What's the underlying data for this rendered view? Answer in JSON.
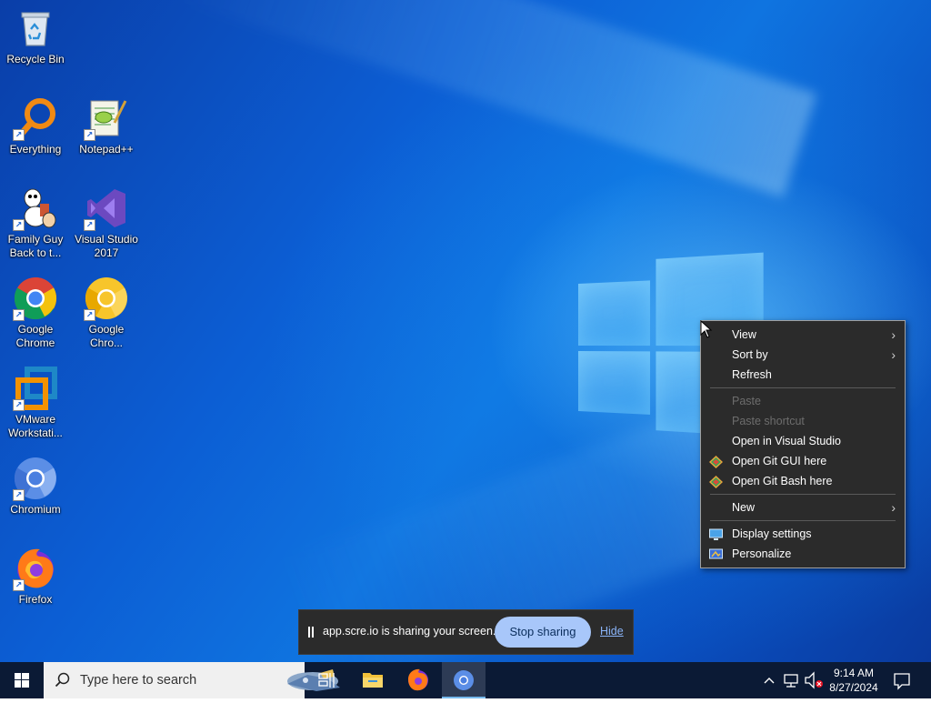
{
  "desktop": {
    "icons": [
      {
        "label": "Recycle Bin",
        "icon": "recycle-bin-icon"
      },
      {
        "label": "Everything",
        "icon": "everything-search-icon"
      },
      {
        "label": "Notepad++",
        "icon": "notepad-plus-plus-icon"
      },
      {
        "label": "Family Guy Back to t...",
        "icon": "family-guy-icon"
      },
      {
        "label": "Visual Studio 2017",
        "icon": "visual-studio-icon"
      },
      {
        "label": "Google Chrome",
        "icon": "chrome-icon"
      },
      {
        "label": "Google Chro...",
        "icon": "chrome-canary-icon"
      },
      {
        "label": "VMware Workstati...",
        "icon": "vmware-icon"
      },
      {
        "label": "Chromium",
        "icon": "chromium-icon"
      },
      {
        "label": "Firefox",
        "icon": "firefox-icon"
      }
    ]
  },
  "context_menu": {
    "items": [
      {
        "label": "View",
        "submenu": true,
        "enabled": true
      },
      {
        "label": "Sort by",
        "submenu": true,
        "enabled": true
      },
      {
        "label": "Refresh",
        "submenu": false,
        "enabled": true
      },
      {
        "label": "Paste",
        "submenu": false,
        "enabled": false
      },
      {
        "label": "Paste shortcut",
        "submenu": false,
        "enabled": false
      },
      {
        "label": "Open in Visual Studio",
        "submenu": false,
        "enabled": true
      },
      {
        "label": "Open Git GUI here",
        "submenu": false,
        "enabled": true,
        "icon": "git-icon"
      },
      {
        "label": "Open Git Bash here",
        "submenu": false,
        "enabled": true,
        "icon": "git-icon"
      },
      {
        "label": "New",
        "submenu": true,
        "enabled": true
      },
      {
        "label": "Display settings",
        "submenu": false,
        "enabled": true,
        "icon": "display-icon"
      },
      {
        "label": "Personalize",
        "submenu": false,
        "enabled": true,
        "icon": "personalize-icon"
      }
    ],
    "arrow_glyph": "›"
  },
  "share_bar": {
    "message": "app.scre.io is sharing your screen.",
    "stop_label": "Stop sharing",
    "hide_label": "Hide"
  },
  "taskbar": {
    "search_placeholder": "Type here to search",
    "apps": [
      "task-view-icon",
      "file-explorer-icon",
      "firefox-icon",
      "chromium-icon"
    ],
    "clock": {
      "time": "9:14 AM",
      "date": "8/27/2024"
    }
  },
  "colors": {
    "menu_bg": "#2b2b2b",
    "taskbar_bg": "#0b1a35",
    "stop_button": "#a8c7fa",
    "hide_link": "#8ab4f8"
  }
}
